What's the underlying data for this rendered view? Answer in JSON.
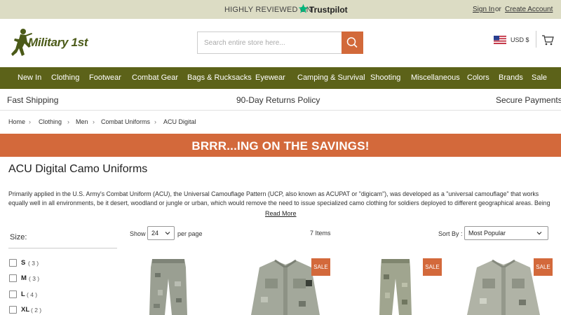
{
  "topbar": {
    "reviewed_text": "HIGHLY REVIEWED ON",
    "trustpilot": "Trustpilot",
    "sign_in": "Sign In",
    "or": "or",
    "create_account": "Create Account"
  },
  "header": {
    "logo_text": "Military 1st",
    "search_placeholder": "Search entire store here...",
    "currency": "USD $"
  },
  "nav": {
    "items": [
      "New In",
      "Clothing",
      "Footwear",
      "Combat Gear",
      "Bags & Rucksacks",
      "Eyewear",
      "Camping & Survival",
      "Shooting",
      "Miscellaneous",
      "Colors",
      "Brands",
      "Sale"
    ]
  },
  "benefits": {
    "shipping": "Fast Shipping",
    "returns": "90-Day Returns Policy",
    "payments": "Secure Payments"
  },
  "breadcrumb": {
    "items": [
      "Home",
      "Clothing",
      "Men",
      "Combat Uniforms",
      "ACU Digital"
    ],
    "separator": "›"
  },
  "promo": {
    "text": "BRRR...ING ON THE SAVINGS!"
  },
  "page": {
    "title": "ACU Digital Camo Uniforms",
    "description": "Primarily applied in the U.S. Army's Combat Uniform (ACU), the Universal Camouflage Pattern (UCP, also known as ACUPAT or \"digicam\"), was developed as a \"universal camouflage\" that works equally well in all environments, be it desert, woodland or jungle or urban, which would remove the need to issue specialized camo clothing for soldiers deployed to different geographical areas. Being",
    "read_more": "Read More"
  },
  "filters": {
    "size_title": "Size:",
    "options": [
      {
        "label": "S",
        "count": "( 3 )"
      },
      {
        "label": "M",
        "count": "( 3 )"
      },
      {
        "label": "L",
        "count": "( 4 )"
      },
      {
        "label": "XL",
        "count": "( 2 )"
      }
    ]
  },
  "toolbar": {
    "show_label": "Show",
    "show_value": "24",
    "per_page": "per page",
    "items_count": "7 Items",
    "sort_label": "Sort By :",
    "sort_value": "Most Popular"
  },
  "products": {
    "sale_label": "SALE"
  },
  "colors": {
    "topbar_bg": "#dcdcc4",
    "nav_bg": "#5c6219",
    "accent_orange": "#d3693b",
    "logo_green": "#4b5a18"
  }
}
